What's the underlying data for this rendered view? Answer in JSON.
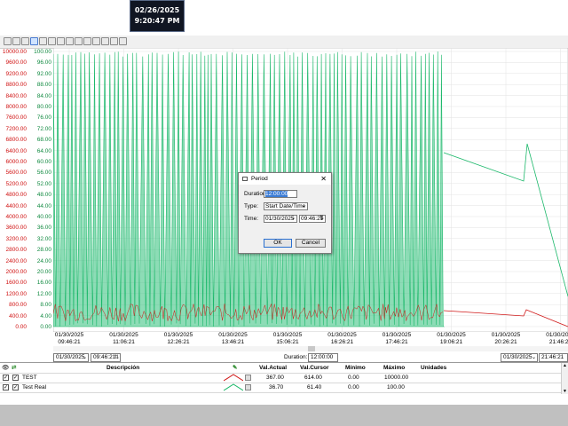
{
  "clock": {
    "date": "02/26/2025",
    "time": "9:20:47 PM"
  },
  "toolbar": {
    "icons": [
      "play-icon",
      "stop-icon",
      "print-icon",
      "zoom-box-icon",
      "zoom-extents-icon",
      "zoom-y-icon",
      "zoom-in-icon",
      "zoom-out-icon",
      "tools-icon",
      "pen-icon",
      "table-icon",
      "layout-icon",
      "save-icon",
      "cursor-icon"
    ]
  },
  "axes": {
    "left_ticks": [
      "10000.00",
      "9600.00",
      "9200.00",
      "8800.00",
      "8400.00",
      "8000.00",
      "7600.00",
      "7200.00",
      "6800.00",
      "6400.00",
      "6000.00",
      "5600.00",
      "5200.00",
      "4800.00",
      "4400.00",
      "4000.00",
      "3600.00",
      "3200.00",
      "2800.00",
      "2400.00",
      "2000.00",
      "1600.00",
      "1200.00",
      "800.00",
      "400.00",
      "0.00"
    ],
    "mid_ticks": [
      "100.00",
      "96.00",
      "92.00",
      "88.00",
      "84.00",
      "80.00",
      "76.00",
      "72.00",
      "68.00",
      "64.00",
      "60.00",
      "56.00",
      "52.00",
      "48.00",
      "44.00",
      "40.00",
      "36.00",
      "32.00",
      "28.00",
      "24.00",
      "20.00",
      "16.00",
      "12.00",
      "8.00",
      "4.00",
      "0.00"
    ],
    "x_ticks": [
      {
        "date": "01/30/2025",
        "time": "09:46:21"
      },
      {
        "date": "01/30/2025",
        "time": "11:06:21"
      },
      {
        "date": "01/30/2025",
        "time": "12:26:21"
      },
      {
        "date": "01/30/2025",
        "time": "13:46:21"
      },
      {
        "date": "01/30/2025",
        "time": "15:06:21"
      },
      {
        "date": "01/30/2025",
        "time": "16:26:21"
      },
      {
        "date": "01/30/2025",
        "time": "17:46:21"
      },
      {
        "date": "01/30/2025",
        "time": "19:06:21"
      },
      {
        "date": "01/30/2025",
        "time": "20:26:21"
      },
      {
        "date": "01/30/2025",
        "time": "21:46:21"
      }
    ]
  },
  "colors": {
    "green": "#1bb86a",
    "red": "#d01818",
    "fill": "#2fc07a"
  },
  "controls": {
    "start_date": "01/30/2025",
    "start_time": "09:46:21",
    "duration_label": "Duration:",
    "duration_value": "12:00:00",
    "end_date": "01/30/2025",
    "end_time": "21:46:21"
  },
  "table": {
    "headers": [
      "Descripción",
      "Val.Actual",
      "Val.Cursor",
      "Mínimo",
      "Máximo",
      "Unidades"
    ],
    "rows": [
      {
        "name": "TEST",
        "actual": "367.00",
        "cursor": "614.00",
        "min": "0.00",
        "max": "10000.00",
        "units": ""
      },
      {
        "name": "Test Real",
        "actual": "36.70",
        "cursor": "61.40",
        "min": "0.00",
        "max": "100.00",
        "units": ""
      }
    ]
  },
  "dialog": {
    "title": "Period",
    "duration_label": "Duration:",
    "duration_value": "12:00:00",
    "type_label": "Type:",
    "type_value": "Start Date/Time",
    "time_label": "Time:",
    "time_date": "01/30/2025",
    "time_time": "09:46:21",
    "ok": "OK",
    "cancel": "Cancel"
  }
}
